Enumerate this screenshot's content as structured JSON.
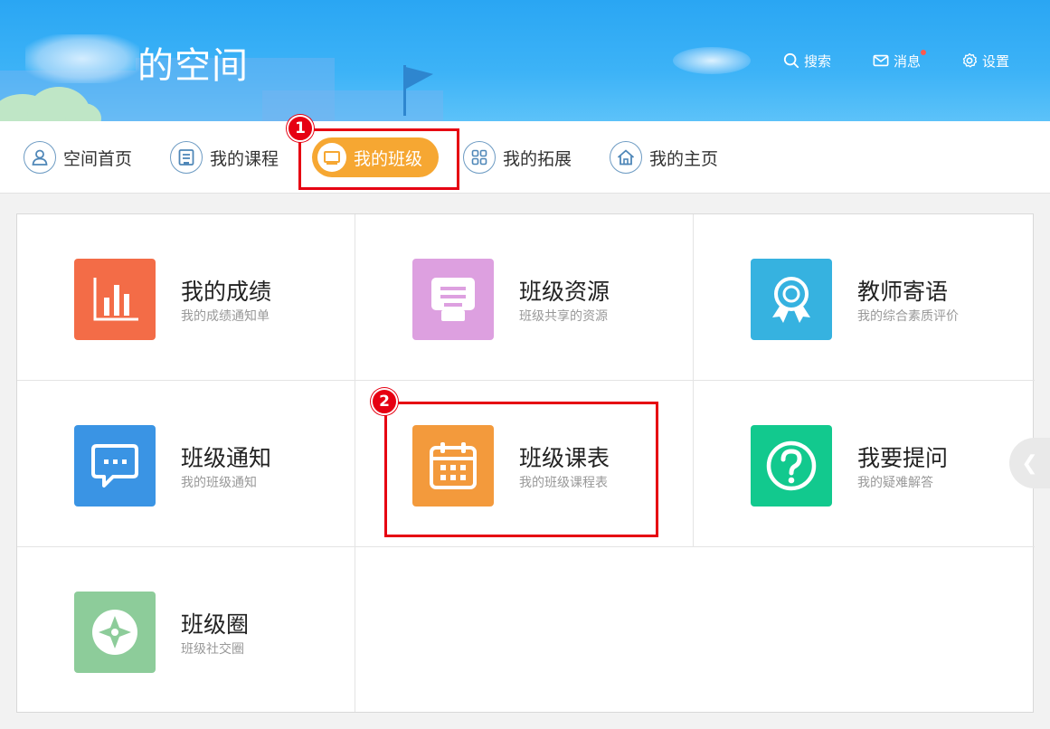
{
  "header": {
    "space_title": "的空间",
    "links": [
      {
        "label": "搜索",
        "icon": "search-icon"
      },
      {
        "label": "消息",
        "icon": "mail-icon"
      },
      {
        "label": "设置",
        "icon": "gear-icon"
      }
    ]
  },
  "nav": {
    "items": [
      {
        "label": "空间首页",
        "icon": "user-icon"
      },
      {
        "label": "我的课程",
        "icon": "course-icon"
      },
      {
        "label": "我的班级",
        "icon": "class-icon",
        "active": true
      },
      {
        "label": "我的拓展",
        "icon": "grid-icon"
      },
      {
        "label": "我的主页",
        "icon": "home-icon"
      }
    ]
  },
  "steps": [
    "1",
    "2"
  ],
  "cards": [
    {
      "title": "我的成绩",
      "desc": "我的成绩通知单",
      "color": "#f36c47",
      "icon": "bar-chart-icon"
    },
    {
      "title": "班级资源",
      "desc": "班级共享的资源",
      "color": "#dda0e0",
      "icon": "document-icon"
    },
    {
      "title": "教师寄语",
      "desc": "我的综合素质评价",
      "color": "#36b2e0",
      "icon": "award-icon"
    },
    {
      "title": "班级通知",
      "desc": "我的班级通知",
      "color": "#3a94e4",
      "icon": "message-icon"
    },
    {
      "title": "班级课表",
      "desc": "我的班级课程表",
      "color": "#f39a3c",
      "icon": "calendar-icon"
    },
    {
      "title": "我要提问",
      "desc": "我的疑难解答",
      "color": "#12c98e",
      "icon": "question-icon"
    },
    {
      "title": "班级圈",
      "desc": "班级社交圈",
      "color": "#8dcc9a",
      "icon": "compass-icon"
    }
  ],
  "colors": {
    "accent": "#f6a732",
    "highlight": "#e60012",
    "banner": "#2aa6f3"
  },
  "side_arrow": "❮"
}
